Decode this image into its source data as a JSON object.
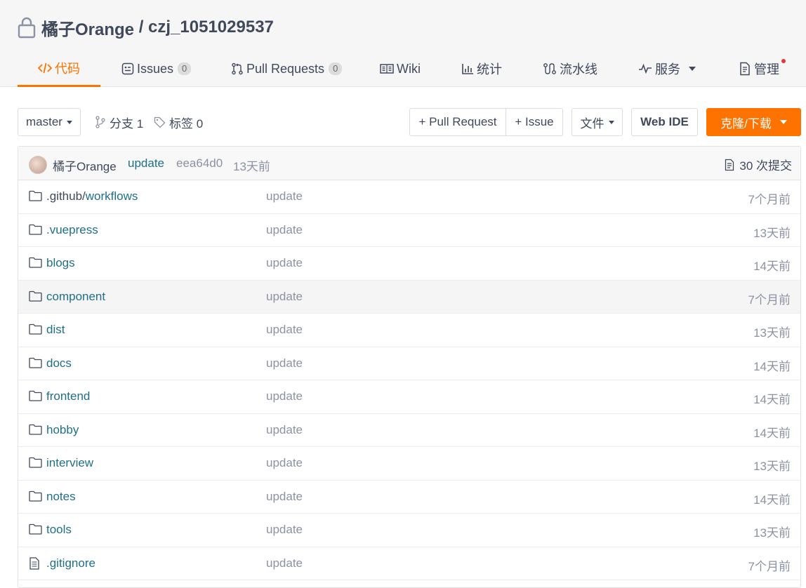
{
  "repo": {
    "owner": "橘子Orange",
    "separator": " / ",
    "name": "czj_1051029537"
  },
  "tabs": [
    {
      "label": "代码",
      "icon": "code-icon"
    },
    {
      "label": "Issues",
      "badge": "0",
      "icon": "issues-icon"
    },
    {
      "label": "Pull Requests",
      "badge": "0",
      "icon": "pull-request-icon"
    },
    {
      "label": "Wiki",
      "icon": "wiki-icon"
    },
    {
      "label": "统计",
      "icon": "stats-icon"
    },
    {
      "label": "流水线",
      "icon": "pipeline-icon"
    },
    {
      "label": "服务",
      "icon": "service-icon"
    },
    {
      "label": "管理",
      "icon": "manage-icon"
    }
  ],
  "toolbar": {
    "branch": "master",
    "branches": "分支 1",
    "tags": "标签 0",
    "pull_request": "+ Pull Request",
    "issue": "+ Issue",
    "file": "文件",
    "web_ide": "Web IDE",
    "clone": "克隆/下载"
  },
  "commit": {
    "author": "橘子Orange",
    "message": "update",
    "sha": "eea64d0",
    "time": "13天前",
    "count": "30 次提交"
  },
  "files": [
    {
      "name_prefix": ".github/",
      "name": "workflows",
      "type": "folder",
      "message": "update",
      "time": "7个月前"
    },
    {
      "name_prefix": "",
      "name": ".vuepress",
      "type": "folder",
      "message": "update",
      "time": "13天前"
    },
    {
      "name_prefix": "",
      "name": "blogs",
      "type": "folder",
      "message": "update",
      "time": "14天前"
    },
    {
      "name_prefix": "",
      "name": "component",
      "type": "folder",
      "message": "update",
      "time": "7个月前"
    },
    {
      "name_prefix": "",
      "name": "dist",
      "type": "folder",
      "message": "update",
      "time": "13天前"
    },
    {
      "name_prefix": "",
      "name": "docs",
      "type": "folder",
      "message": "update",
      "time": "14天前"
    },
    {
      "name_prefix": "",
      "name": "frontend",
      "type": "folder",
      "message": "update",
      "time": "14天前"
    },
    {
      "name_prefix": "",
      "name": "hobby",
      "type": "folder",
      "message": "update",
      "time": "14天前"
    },
    {
      "name_prefix": "",
      "name": "interview",
      "type": "folder",
      "message": "update",
      "time": "13天前"
    },
    {
      "name_prefix": "",
      "name": "notes",
      "type": "folder",
      "message": "update",
      "time": "14天前"
    },
    {
      "name_prefix": "",
      "name": "tools",
      "type": "folder",
      "message": "update",
      "time": "13天前"
    },
    {
      "name_prefix": "",
      "name": ".gitignore",
      "type": "file",
      "message": "update",
      "time": "7个月前"
    }
  ],
  "colors": {
    "accent": "#fe7300",
    "link": "#1f6f8b",
    "muted": "#8c92a4"
  }
}
